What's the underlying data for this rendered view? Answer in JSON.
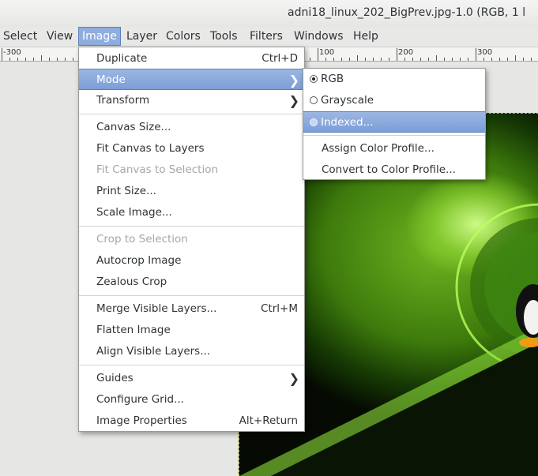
{
  "window": {
    "title": "adni18_linux_202_BigPrev.jpg-1.0 (RGB, 1 l"
  },
  "menubar": {
    "items": [
      "Select",
      "View",
      "Image",
      "Layer",
      "Colors",
      "Tools",
      "Filters",
      "Windows",
      "Help"
    ],
    "open_item": "Image"
  },
  "ruler": {
    "labels": [
      "-300",
      "100",
      "200",
      "300"
    ]
  },
  "image_menu": {
    "items": [
      {
        "label": "Duplicate",
        "accel": "Ctrl+D"
      },
      {
        "label": "Mode",
        "submenu": true,
        "highlighted": true
      },
      {
        "label": "Transform",
        "submenu": true
      },
      {
        "label": "Canvas Size..."
      },
      {
        "label": "Fit Canvas to Layers"
      },
      {
        "label": "Fit Canvas to Selection",
        "disabled": true
      },
      {
        "label": "Print Size..."
      },
      {
        "label": "Scale Image..."
      },
      {
        "label": "Crop to Selection",
        "disabled": true
      },
      {
        "label": "Autocrop Image"
      },
      {
        "label": "Zealous Crop"
      },
      {
        "label": "Merge Visible Layers...",
        "accel": "Ctrl+M"
      },
      {
        "label": "Flatten Image"
      },
      {
        "label": "Align Visible Layers..."
      },
      {
        "label": "Guides",
        "submenu": true
      },
      {
        "label": "Configure Grid..."
      },
      {
        "label": "Image Properties",
        "accel": "Alt+Return"
      }
    ]
  },
  "mode_submenu": {
    "items": [
      {
        "label": "RGB",
        "radio": true,
        "checked": true
      },
      {
        "label": "Grayscale",
        "radio": true,
        "checked": false
      },
      {
        "label": "Indexed...",
        "radio": true,
        "checked": false,
        "highlighted": true
      },
      {
        "label": "Assign Color Profile..."
      },
      {
        "label": "Convert to Color Profile..."
      }
    ]
  },
  "icons": {
    "submenu_arrow": "chevron-right-icon",
    "radio": "radio-icon"
  },
  "colors": {
    "highlight": "#7b9ed8",
    "menu_bg": "#ffffff",
    "disabled_text": "#a5a7a4",
    "image_green": "#4a8c12"
  }
}
